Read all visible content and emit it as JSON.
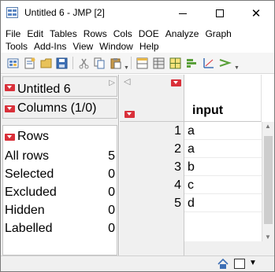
{
  "window": {
    "title": "Untitled 6 - JMP [2]",
    "minimize_glyph": "—",
    "maximize_glyph": "☐",
    "close_glyph": "✕"
  },
  "menu": {
    "row1": [
      "File",
      "Edit",
      "Tables",
      "Rows",
      "Cols",
      "DOE",
      "Analyze",
      "Graph"
    ],
    "row2": [
      "Tools",
      "Add-Ins",
      "View",
      "Window",
      "Help"
    ]
  },
  "toolbar": {
    "icons": [
      "new-table-icon",
      "new-script-icon",
      "open-icon",
      "save-icon",
      "cut-icon",
      "copy-icon",
      "paste-icon",
      "layout-icon",
      "table-icon",
      "grid-icon",
      "bar-chart-icon",
      "fit-icon",
      "scatter-icon"
    ]
  },
  "panels": {
    "table_name": "Untitled 6",
    "columns": "Columns (1/0)",
    "rows_title": "Rows"
  },
  "rows_stats": [
    {
      "label": "All rows",
      "value": "5"
    },
    {
      "label": "Selected",
      "value": "0"
    },
    {
      "label": "Excluded",
      "value": "0"
    },
    {
      "label": "Hidden",
      "value": "0"
    },
    {
      "label": "Labelled",
      "value": "0"
    }
  ],
  "grid": {
    "column": "input",
    "row_numbers": [
      "1",
      "2",
      "3",
      "4",
      "5"
    ],
    "values": [
      "a",
      "a",
      "b",
      "c",
      "d"
    ]
  },
  "colors": {
    "accent_red": "#d9303a",
    "selection_blue": "#5a86c4"
  }
}
